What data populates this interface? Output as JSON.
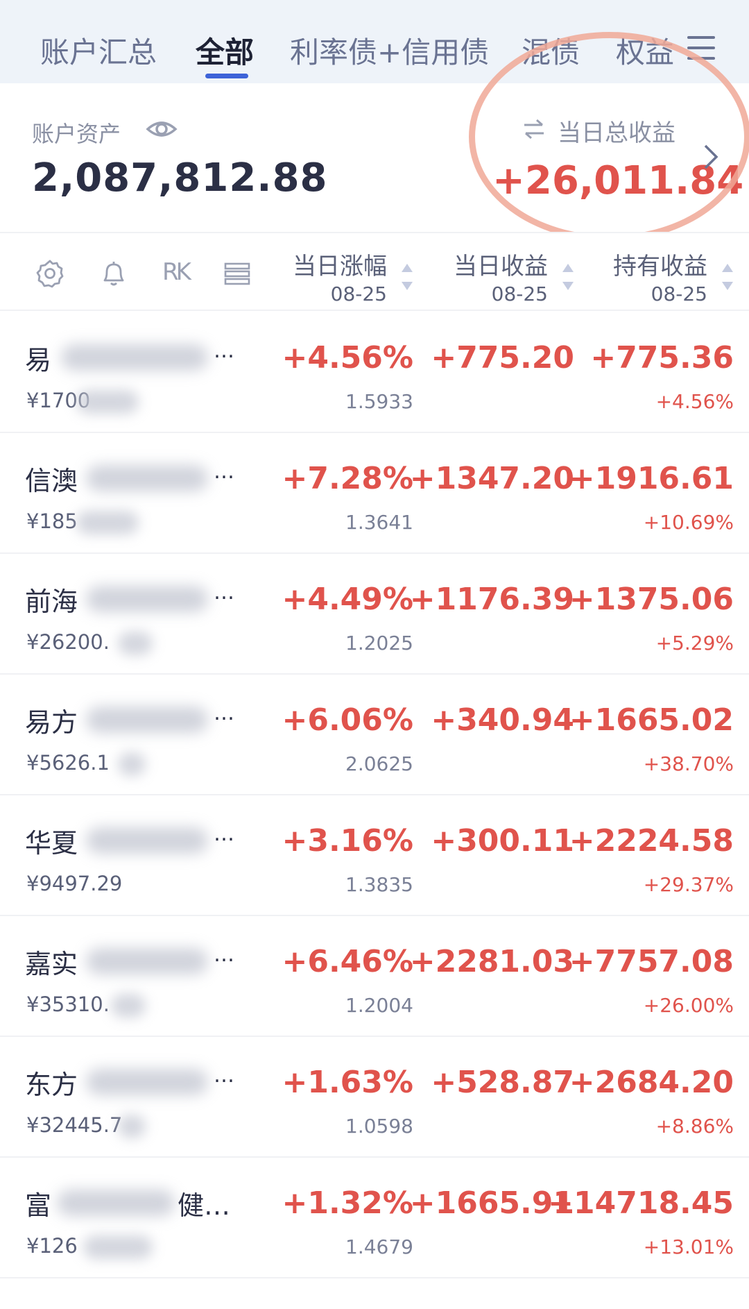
{
  "tabs": [
    {
      "label": "账户汇总",
      "active": false
    },
    {
      "label": "全部",
      "active": true
    },
    {
      "label": "利率债+信用债",
      "active": false
    },
    {
      "label": "混债",
      "active": false
    },
    {
      "label": "权益",
      "active": false
    }
  ],
  "summary": {
    "asset_label": "账户资产",
    "asset_value": "2,087,812.88",
    "total_label": "当日总收益",
    "total_value": "+26,011.84"
  },
  "header": {
    "col1": {
      "title": "当日涨幅",
      "date": "08-25"
    },
    "col2": {
      "title": "当日收益",
      "date": "08-25"
    },
    "col3": {
      "title": "持有收益",
      "date": "08-25"
    },
    "icon3_text": "RK"
  },
  "rows": [
    {
      "name": "易",
      "ellipsis": "…",
      "amount": "¥1700",
      "change_pct": "+4.56%",
      "nav": "1.5933",
      "daily": "+775.20",
      "hold": "+775.36",
      "hold_pct": "+4.56%"
    },
    {
      "name": "信澳",
      "ellipsis": "…",
      "amount": "¥185",
      "change_pct": "+7.28%",
      "nav": "1.3641",
      "daily": "+1347.20",
      "hold": "+1916.61",
      "hold_pct": "+10.69%"
    },
    {
      "name": "前海",
      "ellipsis": "…",
      "amount": "¥26200.",
      "change_pct": "+4.49%",
      "nav": "1.2025",
      "daily": "+1176.39",
      "hold": "+1375.06",
      "hold_pct": "+5.29%"
    },
    {
      "name": "易方",
      "ellipsis": "…",
      "amount": "¥5626.1",
      "change_pct": "+6.06%",
      "nav": "2.0625",
      "daily": "+340.94",
      "hold": "+1665.02",
      "hold_pct": "+38.70%"
    },
    {
      "name": "华夏",
      "ellipsis": "…",
      "amount": "¥9497.29",
      "change_pct": "+3.16%",
      "nav": "1.3835",
      "daily": "+300.11",
      "hold": "+2224.58",
      "hold_pct": "+29.37%"
    },
    {
      "name": "嘉实",
      "ellipsis": "…",
      "amount": "¥35310.",
      "change_pct": "+6.46%",
      "nav": "1.2004",
      "daily": "+2281.03",
      "hold": "+7757.08",
      "hold_pct": "+26.00%"
    },
    {
      "name": "东方",
      "ellipsis": "…",
      "amount": "¥32445.7",
      "change_pct": "+1.63%",
      "nav": "1.0598",
      "daily": "+528.87",
      "hold": "+2684.20",
      "hold_pct": "+8.86%"
    },
    {
      "name": "富",
      "ellipsis": "健…",
      "amount": "¥126",
      "change_pct": "+1.32%",
      "nav": "1.4679",
      "daily": "+1665.91",
      "hold": "+14718.45",
      "hold_pct": "+13.01%"
    }
  ],
  "colors": {
    "accent": "#3d63d8",
    "gain": "#e0534c",
    "annotation": "#f0a896"
  }
}
